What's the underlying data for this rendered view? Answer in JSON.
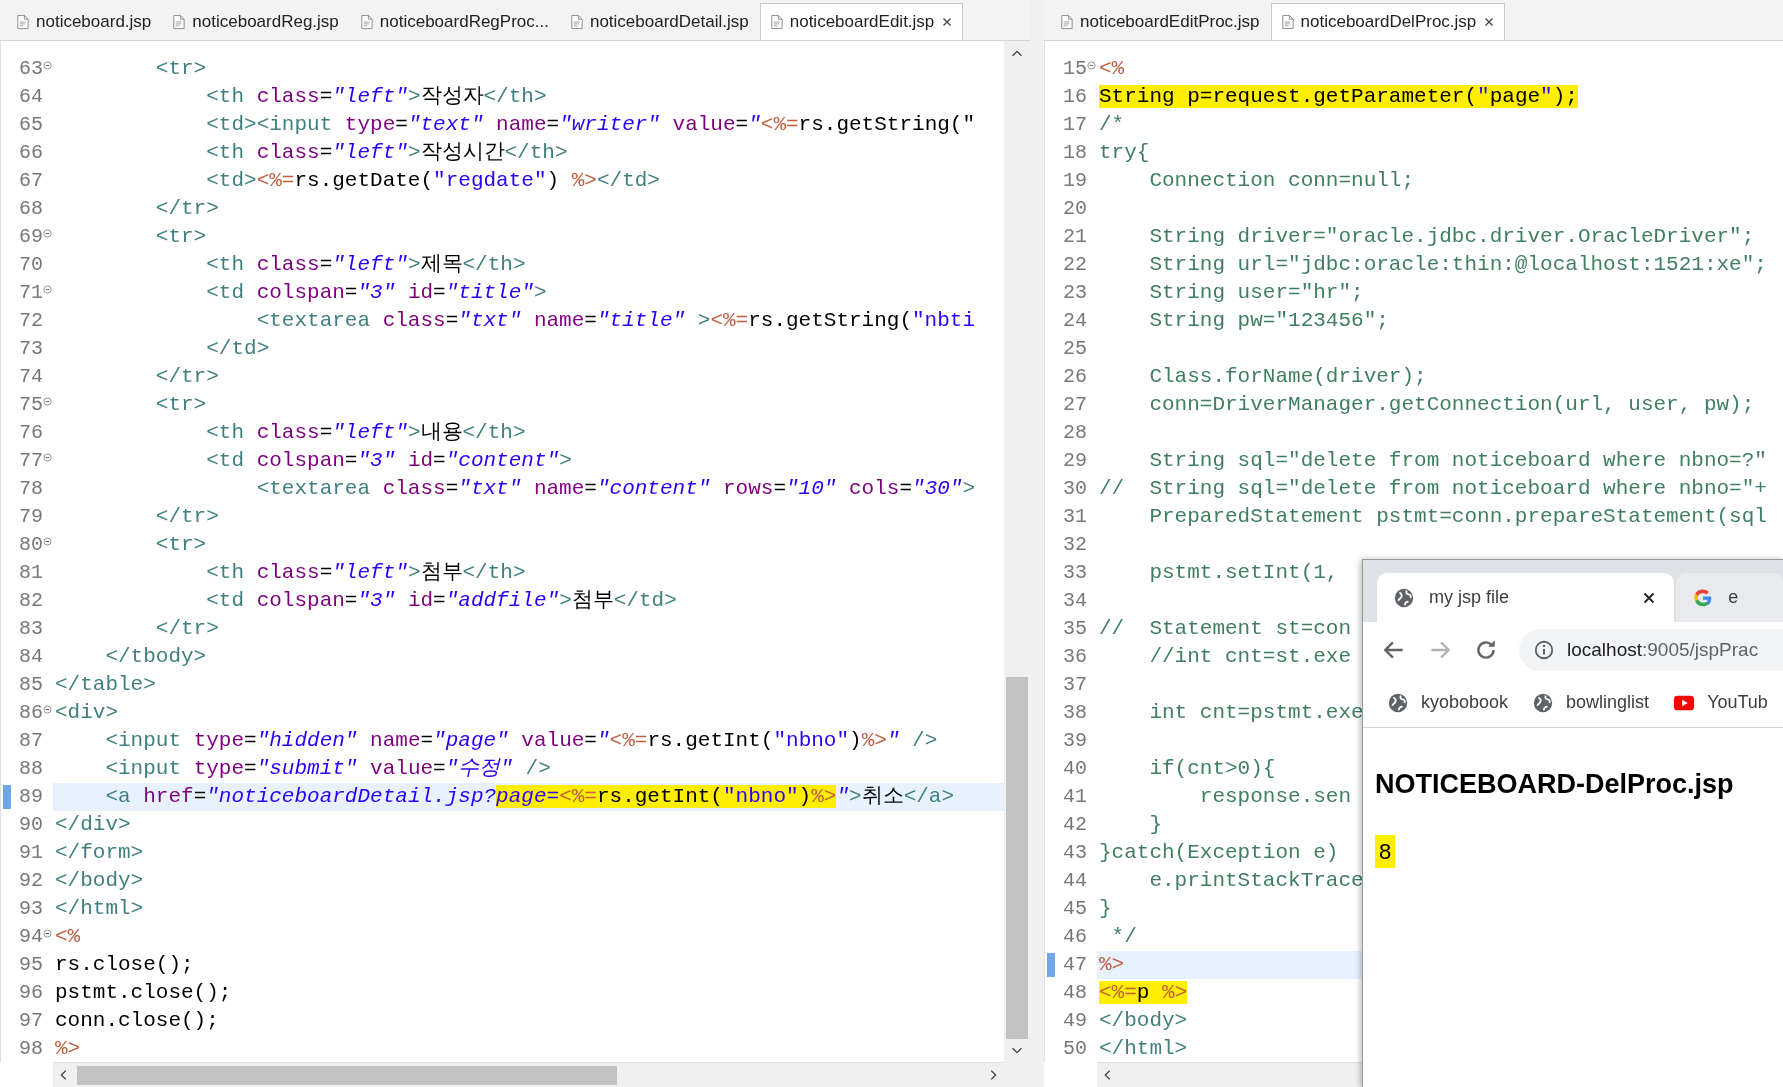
{
  "editor_tabs": [
    {
      "label": "noticeboard.jsp",
      "selected": false,
      "closable": false
    },
    {
      "label": "noticeboardReg.jsp",
      "selected": false,
      "closable": false
    },
    {
      "label": "noticeboardRegProc...",
      "selected": false,
      "closable": false
    },
    {
      "label": "noticeboardDetail.jsp",
      "selected": false,
      "closable": false
    },
    {
      "label": "noticeboardEdit.jsp",
      "selected": true,
      "closable": true
    }
  ],
  "left_editor": {
    "lines": [
      {
        "num": "63",
        "fold": true,
        "current": false,
        "tokens": [
          {
            "text": "        <tr>",
            "kind": "tag"
          }
        ]
      },
      {
        "num": "64",
        "fold": false,
        "current": false,
        "tokens": [
          {
            "text": "            <th",
            "kind": "tag"
          },
          {
            "text": " class",
            "kind": "attr"
          },
          {
            "text": "=",
            "kind": "plain"
          },
          {
            "text": "\"left\"",
            "kind": "value"
          },
          {
            "text": ">",
            "kind": "tag"
          },
          {
            "text": "작성자",
            "kind": "plain"
          },
          {
            "text": "</th>",
            "kind": "tag"
          }
        ]
      },
      {
        "num": "65",
        "fold": false,
        "current": false,
        "tokens": [
          {
            "text": "            <td><input",
            "kind": "tag"
          },
          {
            "text": " type",
            "kind": "attr"
          },
          {
            "text": "=",
            "kind": "plain"
          },
          {
            "text": "\"text\"",
            "kind": "value"
          },
          {
            "text": " name",
            "kind": "attr"
          },
          {
            "text": "=",
            "kind": "plain"
          },
          {
            "text": "\"writer\"",
            "kind": "value"
          },
          {
            "text": " value",
            "kind": "attr"
          },
          {
            "text": "=",
            "kind": "plain"
          },
          {
            "text": "\"",
            "kind": "value"
          },
          {
            "text": "<%=",
            "kind": "jsp"
          },
          {
            "text": "rs.getString(\"",
            "kind": "plain"
          }
        ]
      },
      {
        "num": "66",
        "fold": false,
        "current": false,
        "tokens": [
          {
            "text": "            <th",
            "kind": "tag"
          },
          {
            "text": " class",
            "kind": "attr"
          },
          {
            "text": "=",
            "kind": "plain"
          },
          {
            "text": "\"left\"",
            "kind": "value"
          },
          {
            "text": ">",
            "kind": "tag"
          },
          {
            "text": "작성시간",
            "kind": "plain"
          },
          {
            "text": "</th>",
            "kind": "tag"
          }
        ]
      },
      {
        "num": "67",
        "fold": false,
        "current": false,
        "tokens": [
          {
            "text": "            <td>",
            "kind": "tag"
          },
          {
            "text": "<%=",
            "kind": "jsp"
          },
          {
            "text": "rs.getDate(",
            "kind": "plain"
          },
          {
            "text": "\"regdate\"",
            "kind": "string"
          },
          {
            "text": ") ",
            "kind": "plain"
          },
          {
            "text": "%>",
            "kind": "jsp"
          },
          {
            "text": "</td>",
            "kind": "tag"
          }
        ]
      },
      {
        "num": "68",
        "fold": false,
        "current": false,
        "tokens": [
          {
            "text": "        </tr>",
            "kind": "tag"
          }
        ]
      },
      {
        "num": "69",
        "fold": true,
        "current": false,
        "tokens": [
          {
            "text": "        <tr>",
            "kind": "tag"
          }
        ]
      },
      {
        "num": "70",
        "fold": false,
        "current": false,
        "tokens": [
          {
            "text": "            <th",
            "kind": "tag"
          },
          {
            "text": " class",
            "kind": "attr"
          },
          {
            "text": "=",
            "kind": "plain"
          },
          {
            "text": "\"left\"",
            "kind": "value"
          },
          {
            "text": ">",
            "kind": "tag"
          },
          {
            "text": "제목",
            "kind": "plain"
          },
          {
            "text": "</th>",
            "kind": "tag"
          }
        ]
      },
      {
        "num": "71",
        "fold": true,
        "current": false,
        "tokens": [
          {
            "text": "            <td",
            "kind": "tag"
          },
          {
            "text": " colspan",
            "kind": "attr"
          },
          {
            "text": "=",
            "kind": "plain"
          },
          {
            "text": "\"3\"",
            "kind": "value"
          },
          {
            "text": " id",
            "kind": "attr"
          },
          {
            "text": "=",
            "kind": "plain"
          },
          {
            "text": "\"title\"",
            "kind": "value"
          },
          {
            "text": ">",
            "kind": "tag"
          }
        ]
      },
      {
        "num": "72",
        "fold": false,
        "current": false,
        "tokens": [
          {
            "text": "                <textarea",
            "kind": "tag"
          },
          {
            "text": " class",
            "kind": "attr"
          },
          {
            "text": "=",
            "kind": "plain"
          },
          {
            "text": "\"txt\"",
            "kind": "value"
          },
          {
            "text": " name",
            "kind": "attr"
          },
          {
            "text": "=",
            "kind": "plain"
          },
          {
            "text": "\"title\"",
            "kind": "value"
          },
          {
            "text": " >",
            "kind": "tag"
          },
          {
            "text": "<%=",
            "kind": "jsp"
          },
          {
            "text": "rs.getString(",
            "kind": "plain"
          },
          {
            "text": "\"nbti",
            "kind": "string"
          }
        ]
      },
      {
        "num": "73",
        "fold": false,
        "current": false,
        "tokens": [
          {
            "text": "            </td>",
            "kind": "tag"
          }
        ]
      },
      {
        "num": "74",
        "fold": false,
        "current": false,
        "tokens": [
          {
            "text": "        </tr>",
            "kind": "tag"
          }
        ]
      },
      {
        "num": "75",
        "fold": true,
        "current": false,
        "tokens": [
          {
            "text": "        <tr>",
            "kind": "tag"
          }
        ]
      },
      {
        "num": "76",
        "fold": false,
        "current": false,
        "tokens": [
          {
            "text": "            <th",
            "kind": "tag"
          },
          {
            "text": " class",
            "kind": "attr"
          },
          {
            "text": "=",
            "kind": "plain"
          },
          {
            "text": "\"left\"",
            "kind": "value"
          },
          {
            "text": ">",
            "kind": "tag"
          },
          {
            "text": "내용",
            "kind": "plain"
          },
          {
            "text": "</th>",
            "kind": "tag"
          }
        ]
      },
      {
        "num": "77",
        "fold": true,
        "current": false,
        "tokens": [
          {
            "text": "            <td",
            "kind": "tag"
          },
          {
            "text": " colspan",
            "kind": "attr"
          },
          {
            "text": "=",
            "kind": "plain"
          },
          {
            "text": "\"3\"",
            "kind": "value"
          },
          {
            "text": " id",
            "kind": "attr"
          },
          {
            "text": "=",
            "kind": "plain"
          },
          {
            "text": "\"content\"",
            "kind": "value"
          },
          {
            "text": ">",
            "kind": "tag"
          }
        ]
      },
      {
        "num": "78",
        "fold": false,
        "current": false,
        "tokens": [
          {
            "text": "                <textarea",
            "kind": "tag"
          },
          {
            "text": " class",
            "kind": "attr"
          },
          {
            "text": "=",
            "kind": "plain"
          },
          {
            "text": "\"txt\"",
            "kind": "value"
          },
          {
            "text": " name",
            "kind": "attr"
          },
          {
            "text": "=",
            "kind": "plain"
          },
          {
            "text": "\"content\"",
            "kind": "value"
          },
          {
            "text": " rows",
            "kind": "attr"
          },
          {
            "text": "=",
            "kind": "plain"
          },
          {
            "text": "\"10\"",
            "kind": "value"
          },
          {
            "text": " cols",
            "kind": "attr"
          },
          {
            "text": "=",
            "kind": "plain"
          },
          {
            "text": "\"30\"",
            "kind": "value"
          },
          {
            "text": ">",
            "kind": "tag"
          }
        ]
      },
      {
        "num": "79",
        "fold": false,
        "current": false,
        "tokens": [
          {
            "text": "        </tr>",
            "kind": "tag"
          }
        ]
      },
      {
        "num": "80",
        "fold": true,
        "current": false,
        "tokens": [
          {
            "text": "        <tr>",
            "kind": "tag"
          }
        ]
      },
      {
        "num": "81",
        "fold": false,
        "current": false,
        "tokens": [
          {
            "text": "            <th",
            "kind": "tag"
          },
          {
            "text": " class",
            "kind": "attr"
          },
          {
            "text": "=",
            "kind": "plain"
          },
          {
            "text": "\"left\"",
            "kind": "value"
          },
          {
            "text": ">",
            "kind": "tag"
          },
          {
            "text": "첨부",
            "kind": "plain"
          },
          {
            "text": "</th>",
            "kind": "tag"
          }
        ]
      },
      {
        "num": "82",
        "fold": false,
        "current": false,
        "tokens": [
          {
            "text": "            <td",
            "kind": "tag"
          },
          {
            "text": " colspan",
            "kind": "attr"
          },
          {
            "text": "=",
            "kind": "plain"
          },
          {
            "text": "\"3\"",
            "kind": "value"
          },
          {
            "text": " id",
            "kind": "attr"
          },
          {
            "text": "=",
            "kind": "plain"
          },
          {
            "text": "\"addfile\"",
            "kind": "value"
          },
          {
            "text": ">",
            "kind": "tag"
          },
          {
            "text": "첨부",
            "kind": "plain"
          },
          {
            "text": "</td>",
            "kind": "tag"
          }
        ]
      },
      {
        "num": "83",
        "fold": false,
        "current": false,
        "tokens": [
          {
            "text": "        </tr>",
            "kind": "tag"
          }
        ]
      },
      {
        "num": "84",
        "fold": false,
        "current": false,
        "tokens": [
          {
            "text": "    </tbody>",
            "kind": "tag"
          }
        ]
      },
      {
        "num": "85",
        "fold": false,
        "current": false,
        "tokens": [
          {
            "text": "</table>",
            "kind": "tag"
          }
        ]
      },
      {
        "num": "86",
        "fold": true,
        "current": false,
        "tokens": [
          {
            "text": "<div>",
            "kind": "tag"
          }
        ]
      },
      {
        "num": "87",
        "fold": false,
        "current": false,
        "tokens": [
          {
            "text": "    <input",
            "kind": "tag"
          },
          {
            "text": " type",
            "kind": "attr"
          },
          {
            "text": "=",
            "kind": "plain"
          },
          {
            "text": "\"hidden\"",
            "kind": "value"
          },
          {
            "text": " name",
            "kind": "attr"
          },
          {
            "text": "=",
            "kind": "plain"
          },
          {
            "text": "\"page\"",
            "kind": "value"
          },
          {
            "text": " value",
            "kind": "attr"
          },
          {
            "text": "=",
            "kind": "plain"
          },
          {
            "text": "\"",
            "kind": "value"
          },
          {
            "text": "<%=",
            "kind": "jsp"
          },
          {
            "text": "rs.getInt(",
            "kind": "plain"
          },
          {
            "text": "\"nbno\"",
            "kind": "string"
          },
          {
            "text": ")",
            "kind": "plain"
          },
          {
            "text": "%>",
            "kind": "jsp"
          },
          {
            "text": "\"",
            "kind": "value"
          },
          {
            "text": " />",
            "kind": "tag"
          }
        ]
      },
      {
        "num": "88",
        "fold": false,
        "current": false,
        "tokens": [
          {
            "text": "    <input",
            "kind": "tag"
          },
          {
            "text": " type",
            "kind": "attr"
          },
          {
            "text": "=",
            "kind": "plain"
          },
          {
            "text": "\"submit\"",
            "kind": "value"
          },
          {
            "text": " value",
            "kind": "attr"
          },
          {
            "text": "=",
            "kind": "plain"
          },
          {
            "text": "\"수정\"",
            "kind": "value"
          },
          {
            "text": " />",
            "kind": "tag"
          }
        ]
      },
      {
        "num": "89",
        "fold": false,
        "current": true,
        "tokens": [
          {
            "text": "    <a",
            "kind": "tag"
          },
          {
            "text": " href",
            "kind": "attr"
          },
          {
            "text": "=",
            "kind": "plain"
          },
          {
            "text": "\"noticeboardDetail.jsp?",
            "kind": "value"
          },
          {
            "text": "page=",
            "kind": "value",
            "highlight": true
          },
          {
            "text": "<%=",
            "kind": "jsp",
            "highlight": true
          },
          {
            "text": "rs.getInt(",
            "kind": "plain",
            "highlight": true
          },
          {
            "text": "\"nbno\"",
            "kind": "string",
            "highlight": true
          },
          {
            "text": ")",
            "kind": "plain",
            "highlight": true
          },
          {
            "text": "%>",
            "kind": "jsp",
            "highlight": true
          },
          {
            "text": "\"",
            "kind": "value"
          },
          {
            "text": ">",
            "kind": "tag"
          },
          {
            "text": "취소",
            "kind": "plain"
          },
          {
            "text": "</a>",
            "kind": "tag"
          }
        ]
      },
      {
        "num": "90",
        "fold": false,
        "current": false,
        "tokens": [
          {
            "text": "</div>",
            "kind": "tag"
          }
        ]
      },
      {
        "num": "91",
        "fold": false,
        "current": false,
        "tokens": [
          {
            "text": "</form>",
            "kind": "tag"
          }
        ]
      },
      {
        "num": "92",
        "fold": false,
        "current": false,
        "tokens": [
          {
            "text": "</body>",
            "kind": "tag"
          }
        ]
      },
      {
        "num": "93",
        "fold": false,
        "current": false,
        "tokens": [
          {
            "text": "</html>",
            "kind": "tag"
          }
        ]
      },
      {
        "num": "94",
        "fold": true,
        "current": false,
        "tokens": [
          {
            "text": "<%",
            "kind": "jsp"
          }
        ]
      },
      {
        "num": "95",
        "fold": false,
        "current": false,
        "tokens": [
          {
            "text": "rs.close();",
            "kind": "plain"
          }
        ]
      },
      {
        "num": "96",
        "fold": false,
        "current": false,
        "tokens": [
          {
            "text": "pstmt.close();",
            "kind": "plain"
          }
        ]
      },
      {
        "num": "97",
        "fold": false,
        "current": false,
        "tokens": [
          {
            "text": "conn.close();",
            "kind": "plain"
          }
        ]
      },
      {
        "num": "98",
        "fold": false,
        "current": false,
        "tokens": [
          {
            "text": "%>",
            "kind": "jsp"
          }
        ]
      }
    ]
  },
  "right_tabs": [
    {
      "label": "noticeboardEditProc.jsp",
      "selected": false,
      "closable": false
    },
    {
      "label": "noticeboardDelProc.jsp",
      "selected": true,
      "closable": true
    }
  ],
  "right_editor": {
    "lines": [
      {
        "num": "15",
        "fold": true,
        "current": false,
        "tokens": [
          {
            "text": "<%",
            "kind": "jsp"
          }
        ]
      },
      {
        "num": "16",
        "fold": false,
        "current": false,
        "tokens": [
          {
            "text": "String p=request.getParameter(",
            "kind": "plain",
            "highlight": true
          },
          {
            "text": "\"",
            "kind": "string",
            "highlight": true
          },
          {
            "text": "page",
            "kind": "plain",
            "highlight": true
          },
          {
            "text": "\"",
            "kind": "string",
            "highlight": true
          },
          {
            "text": ");",
            "kind": "plain",
            "highlight": true
          }
        ]
      },
      {
        "num": "17",
        "fold": false,
        "current": false,
        "tokens": [
          {
            "text": "/*",
            "kind": "comment"
          }
        ]
      },
      {
        "num": "18",
        "fold": false,
        "current": false,
        "tokens": [
          {
            "text": "try{",
            "kind": "comment"
          }
        ]
      },
      {
        "num": "19",
        "fold": false,
        "current": false,
        "tokens": [
          {
            "text": "    Connection conn=null;",
            "kind": "comment"
          }
        ]
      },
      {
        "num": "20",
        "fold": false,
        "current": false
      },
      {
        "num": "21",
        "fold": false,
        "current": false,
        "tokens": [
          {
            "text": "    String driver=\"oracle.jdbc.driver.OracleDriver\";",
            "kind": "comment"
          }
        ]
      },
      {
        "num": "22",
        "fold": false,
        "current": false,
        "tokens": [
          {
            "text": "    String url=\"jdbc:oracle:thin:@localhost:1521:xe\";",
            "kind": "comment"
          }
        ]
      },
      {
        "num": "23",
        "fold": false,
        "current": false,
        "tokens": [
          {
            "text": "    String user=\"hr\";",
            "kind": "comment"
          }
        ]
      },
      {
        "num": "24",
        "fold": false,
        "current": false,
        "tokens": [
          {
            "text": "    String pw=\"123456\";",
            "kind": "comment"
          }
        ]
      },
      {
        "num": "25",
        "fold": false,
        "current": false
      },
      {
        "num": "26",
        "fold": false,
        "current": false,
        "tokens": [
          {
            "text": "    Class.forName(driver);",
            "kind": "comment"
          }
        ]
      },
      {
        "num": "27",
        "fold": false,
        "current": false,
        "tokens": [
          {
            "text": "    conn=DriverManager.getConnection(url, user, pw);",
            "kind": "comment"
          }
        ]
      },
      {
        "num": "28",
        "fold": false,
        "current": false
      },
      {
        "num": "29",
        "fold": false,
        "current": false,
        "tokens": [
          {
            "text": "    String sql=\"delete from noticeboard where nbno=?\"",
            "kind": "comment"
          }
        ]
      },
      {
        "num": "30",
        "fold": false,
        "current": false,
        "tokens": [
          {
            "text": "//  String sql=\"delete from noticeboard where nbno=\"+",
            "kind": "comment"
          }
        ]
      },
      {
        "num": "31",
        "fold": false,
        "current": false,
        "tokens": [
          {
            "text": "    PreparedStatement pstmt=conn.prepareStatement(sql",
            "kind": "comment"
          }
        ]
      },
      {
        "num": "32",
        "fold": false,
        "current": false
      },
      {
        "num": "33",
        "fold": false,
        "current": false,
        "tokens": [
          {
            "text": "    pstmt.setInt(1,",
            "kind": "comment"
          }
        ]
      },
      {
        "num": "34",
        "fold": false,
        "current": false
      },
      {
        "num": "35",
        "fold": false,
        "current": false,
        "tokens": [
          {
            "text": "//  Statement st=con",
            "kind": "comment"
          }
        ]
      },
      {
        "num": "36",
        "fold": false,
        "current": false,
        "tokens": [
          {
            "text": "    //int cnt=st.exe",
            "kind": "comment"
          }
        ]
      },
      {
        "num": "37",
        "fold": false,
        "current": false
      },
      {
        "num": "38",
        "fold": false,
        "current": false,
        "tokens": [
          {
            "text": "    int cnt=pstmt.exe",
            "kind": "comment"
          }
        ]
      },
      {
        "num": "39",
        "fold": false,
        "current": false
      },
      {
        "num": "40",
        "fold": false,
        "current": false,
        "tokens": [
          {
            "text": "    if(cnt>0){",
            "kind": "comment"
          }
        ]
      },
      {
        "num": "41",
        "fold": false,
        "current": false,
        "tokens": [
          {
            "text": "        response.sen",
            "kind": "comment"
          }
        ]
      },
      {
        "num": "42",
        "fold": false,
        "current": false,
        "tokens": [
          {
            "text": "    }",
            "kind": "comment"
          }
        ]
      },
      {
        "num": "43",
        "fold": false,
        "current": false,
        "tokens": [
          {
            "text": "}catch(Exception e)",
            "kind": "comment"
          }
        ]
      },
      {
        "num": "44",
        "fold": false,
        "current": false,
        "tokens": [
          {
            "text": "    e.printStackTrace",
            "kind": "comment"
          }
        ]
      },
      {
        "num": "45",
        "fold": false,
        "current": false,
        "tokens": [
          {
            "text": "}",
            "kind": "comment"
          }
        ]
      },
      {
        "num": "46",
        "fold": false,
        "current": false,
        "tokens": [
          {
            "text": " */",
            "kind": "comment"
          }
        ]
      },
      {
        "num": "47",
        "fold": false,
        "current": true,
        "tokens": [
          {
            "text": "%>",
            "kind": "jsp"
          }
        ]
      },
      {
        "num": "48",
        "fold": false,
        "current": false,
        "tokens": [
          {
            "text": "<%=",
            "kind": "jsp",
            "highlight": true
          },
          {
            "text": "p ",
            "kind": "plain",
            "highlight": true
          },
          {
            "text": "%>",
            "kind": "jsp",
            "highlight": true
          }
        ]
      },
      {
        "num": "49",
        "fold": false,
        "current": false,
        "tokens": [
          {
            "text": "</body>",
            "kind": "tag"
          }
        ]
      },
      {
        "num": "50",
        "fold": false,
        "current": false,
        "tokens": [
          {
            "text": "</html>",
            "kind": "tag"
          }
        ]
      }
    ]
  },
  "browser": {
    "tabs": [
      {
        "title": "my jsp file",
        "kind": "globe",
        "selected": true
      },
      {
        "title": "e",
        "kind": "google",
        "selected": false
      }
    ],
    "nav": [
      {
        "kind": "back",
        "disabled": false
      },
      {
        "kind": "forward",
        "disabled": true
      },
      {
        "kind": "reload",
        "disabled": false
      }
    ],
    "address": {
      "host": "localhost",
      "path": ":9005/jspPrac"
    },
    "bookmarks": [
      {
        "label": "kyobobook",
        "kind": "globe"
      },
      {
        "label": "bowlinglist",
        "kind": "globe"
      },
      {
        "label": "YouTub",
        "kind": "youtube"
      }
    ],
    "heading": "NOTICEBOARD-DelProc.jsp",
    "output": {
      "text": "8",
      "highlight": true
    }
  }
}
